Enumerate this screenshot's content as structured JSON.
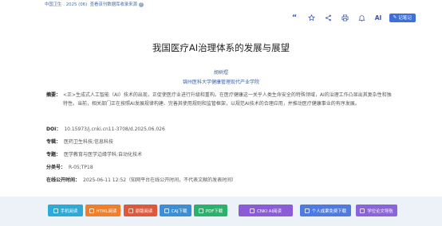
{
  "top": {
    "source": "中国卫生 . 2025 (06)",
    "collection": "查看该刊数据库收录来源",
    "help_icon": "question-circle-icon"
  },
  "toolbar": {
    "icons": [
      "quote-icon",
      "star-icon",
      "share-icon",
      "print-icon",
      "bell-icon"
    ],
    "ai_label": "AI",
    "note_label": "记笔记",
    "accent": "#3f6fd8"
  },
  "paper": {
    "title": "我国医疗AI治理体系的发展与展望",
    "author": "胡树煜",
    "organization": "锦州医科大学健康管理现代产业学院",
    "abstract_label": "摘要：",
    "abstract": "<正>生成式人工智能（AI）技术的出现，正促使医疗业进行升级和重构。在医疗健康这一关乎人类生命安全的特殊领域，AI的治理工作凸显出其复杂性和独特性。当前，相关部门正在按照AI发展规律构建、完善其使用规则和监管框架，以规范AI技术的合理应用，并推动医疗健康事业的有序发展。",
    "doi_label": "DOI：",
    "doi": "10.15973/j.cnki.cn11-3708/d.2025.06.026",
    "column_label": "专辑：",
    "column": "医药卫生科技;信息科技",
    "topic_label": "专题：",
    "topic": "医学教育与医学边缘学科;自动化技术",
    "class_label": "分类号：",
    "class_no": "R-05;TP18",
    "online_label": "在线公开时间：",
    "online_time": "2025-06-11 12:52（知网平台在线公开时间，不代表文献的发表时间）"
  },
  "actions": [
    {
      "label": "手机阅读",
      "icon": "mobile-icon",
      "color": "#2eaad8"
    },
    {
      "label": "HTML阅读",
      "icon": "html-icon",
      "color": "#f07f2b"
    },
    {
      "label": "原版阅读",
      "icon": "book-icon",
      "color": "#e0583b"
    },
    {
      "label": "CAJ下载",
      "icon": "download-icon",
      "color": "#3c8fd6"
    },
    {
      "label": "PDF下载",
      "icon": "download-icon",
      "color": "#2bb36b"
    },
    {
      "label": "CNKI AI阅读",
      "icon": "ai-icon",
      "color": "#8b5bd8"
    },
    {
      "label": "个人成果免费下载",
      "icon": "user-icon",
      "color": "#4f7be0"
    },
    {
      "label": "学位论文导航",
      "icon": "graduation-icon",
      "color": "#8a64d9"
    }
  ]
}
